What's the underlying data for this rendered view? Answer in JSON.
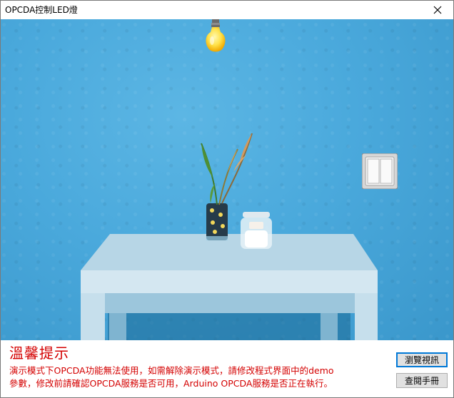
{
  "window": {
    "title": "OPCDA控制LED燈",
    "close_glyph": "close-icon"
  },
  "scene": {
    "bulb_state": "on",
    "bulb_icon": "light-bulb-icon",
    "switch_icon": "wall-switch-icon",
    "colors": {
      "wall": "#4aa9dc",
      "bulb_glow": "#ffe24a",
      "table": "#a9cfe3"
    }
  },
  "notice": {
    "title": "溫馨提示",
    "line1": "演示模式下OPCDA功能無法使用，如需解除演示模式，請修改程式界面中的demo",
    "line2": "參數，修改前請確認OPCDA服務是否可用，Arduino OPCDA服務是否正在執行。",
    "color": "#d40000"
  },
  "buttons": {
    "browse_label": "瀏覽視訊",
    "manual_label": "查閱手冊"
  }
}
